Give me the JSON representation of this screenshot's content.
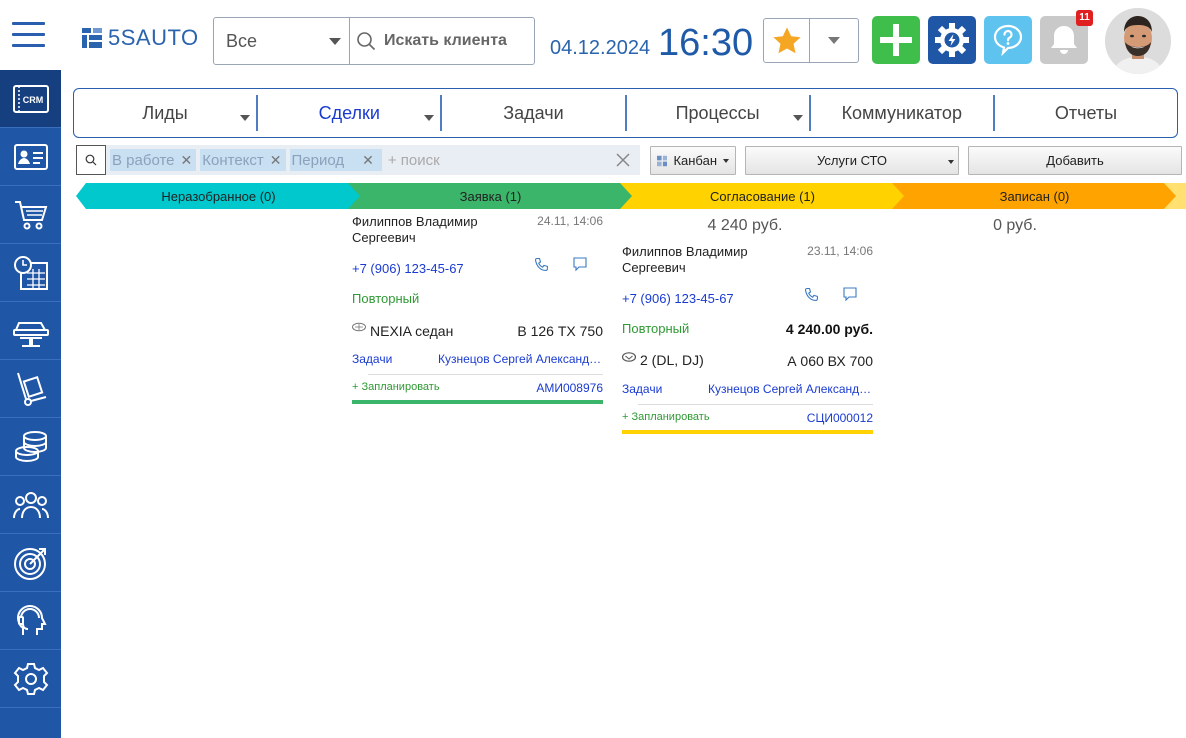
{
  "header": {
    "logo_text": "5SAUTO",
    "scope_select": "Все",
    "client_search_placeholder": "Искать клиента",
    "date": "04.12.2024",
    "time": "16:30",
    "notifications_count": "11"
  },
  "colors": {
    "brand": "#1f56a6",
    "add": "#3fbe4c",
    "help": "#5ec4ef",
    "star": "#f5a623"
  },
  "sidebar": {
    "items": [
      {
        "icon": "crm-icon",
        "label": "CRM"
      },
      {
        "icon": "contacts-card-icon"
      },
      {
        "icon": "cart-icon"
      },
      {
        "icon": "calendar-clock-icon"
      },
      {
        "icon": "car-lift-icon"
      },
      {
        "icon": "hand-truck-icon"
      },
      {
        "icon": "coins-stack-icon"
      },
      {
        "icon": "team-icon"
      },
      {
        "icon": "target-icon"
      },
      {
        "icon": "head-support-icon"
      },
      {
        "icon": "gear-icon"
      }
    ]
  },
  "nav": {
    "tabs": [
      {
        "label": "Лиды",
        "has_menu": true
      },
      {
        "label": "Сделки",
        "has_menu": true,
        "active": true
      },
      {
        "label": "Задачи",
        "has_menu": false
      },
      {
        "label": "Процессы",
        "has_menu": true
      },
      {
        "label": "Коммуникатор",
        "has_menu": false
      },
      {
        "label": "Отчеты",
        "has_menu": false
      }
    ]
  },
  "filters": {
    "chips": [
      "В работе",
      "Контекст",
      "Период"
    ],
    "search_placeholder": "+ поиск",
    "view_label": "Канбан",
    "service_label": "Услуги СТО",
    "add_label": "Добавить"
  },
  "stages": [
    {
      "label": "Неразобранное (0)",
      "color": "#00c8cc",
      "sum": ""
    },
    {
      "label": "Заявка (1)",
      "color": "#3bb56a",
      "sum": ""
    },
    {
      "label": "Согласование (1)",
      "color": "#ffd200",
      "sum": "4 240 руб."
    },
    {
      "label": "Записан (0)",
      "color": "#ffa300",
      "sum": "0 руб."
    },
    {
      "label": "",
      "color": "#ffe070",
      "sum": ""
    }
  ],
  "cards": [
    {
      "client": "Филиппов Владимир Сергеевич",
      "date": "24.11, 14:06",
      "phone": "+7 (906) 123-45-67",
      "status": "Повторный",
      "amount": "",
      "car": "NEXIA седан",
      "plate": "В 126 ТХ 750",
      "tasks_label": "Задачи",
      "manager": "Кузнецов Сергей Александрович",
      "plan_label": "+ Запланировать",
      "code": "АМИ008976",
      "bar_color": "#3bb56a"
    },
    {
      "client": "Филиппов Владимир Сергеевич",
      "date": "23.11, 14:06",
      "phone": "+7 (906) 123-45-67",
      "status": "Повторный",
      "amount": "4 240.00 руб.",
      "car": "2 (DL, DJ)",
      "plate": "А 060 ВХ 700",
      "tasks_label": "Задачи",
      "manager": "Кузнецов Сергей Александрович",
      "plan_label": "+ Запланировать",
      "code": "СЦИ000012",
      "bar_color": "#ffd200"
    }
  ]
}
